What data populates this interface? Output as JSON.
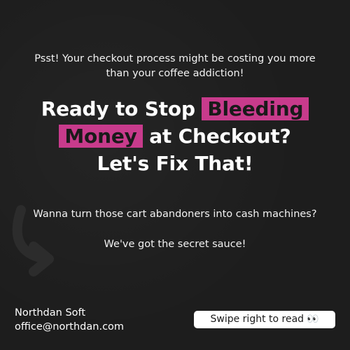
{
  "intro": {
    "line1": "Psst! Your checkout process might be costing you more",
    "line2": "than your coffee addiction!"
  },
  "headline": {
    "part1": "Ready to Stop",
    "highlight1": "Bleeding",
    "highlight2": "Money",
    "part2": "at Checkout?",
    "line3": "Let's Fix That!"
  },
  "body": {
    "question": "Wanna turn those cart abandoners into cash machines?",
    "answer": "We've got the secret sauce!"
  },
  "footer": {
    "company": "Northdan Soft",
    "email": "office@northdan.com",
    "swipe_label": "Swipe right to read",
    "swipe_icon": "eyes-icon"
  },
  "colors": {
    "background": "#1d1d1d",
    "highlight": "#c83b8c",
    "text": "#ffffff"
  }
}
